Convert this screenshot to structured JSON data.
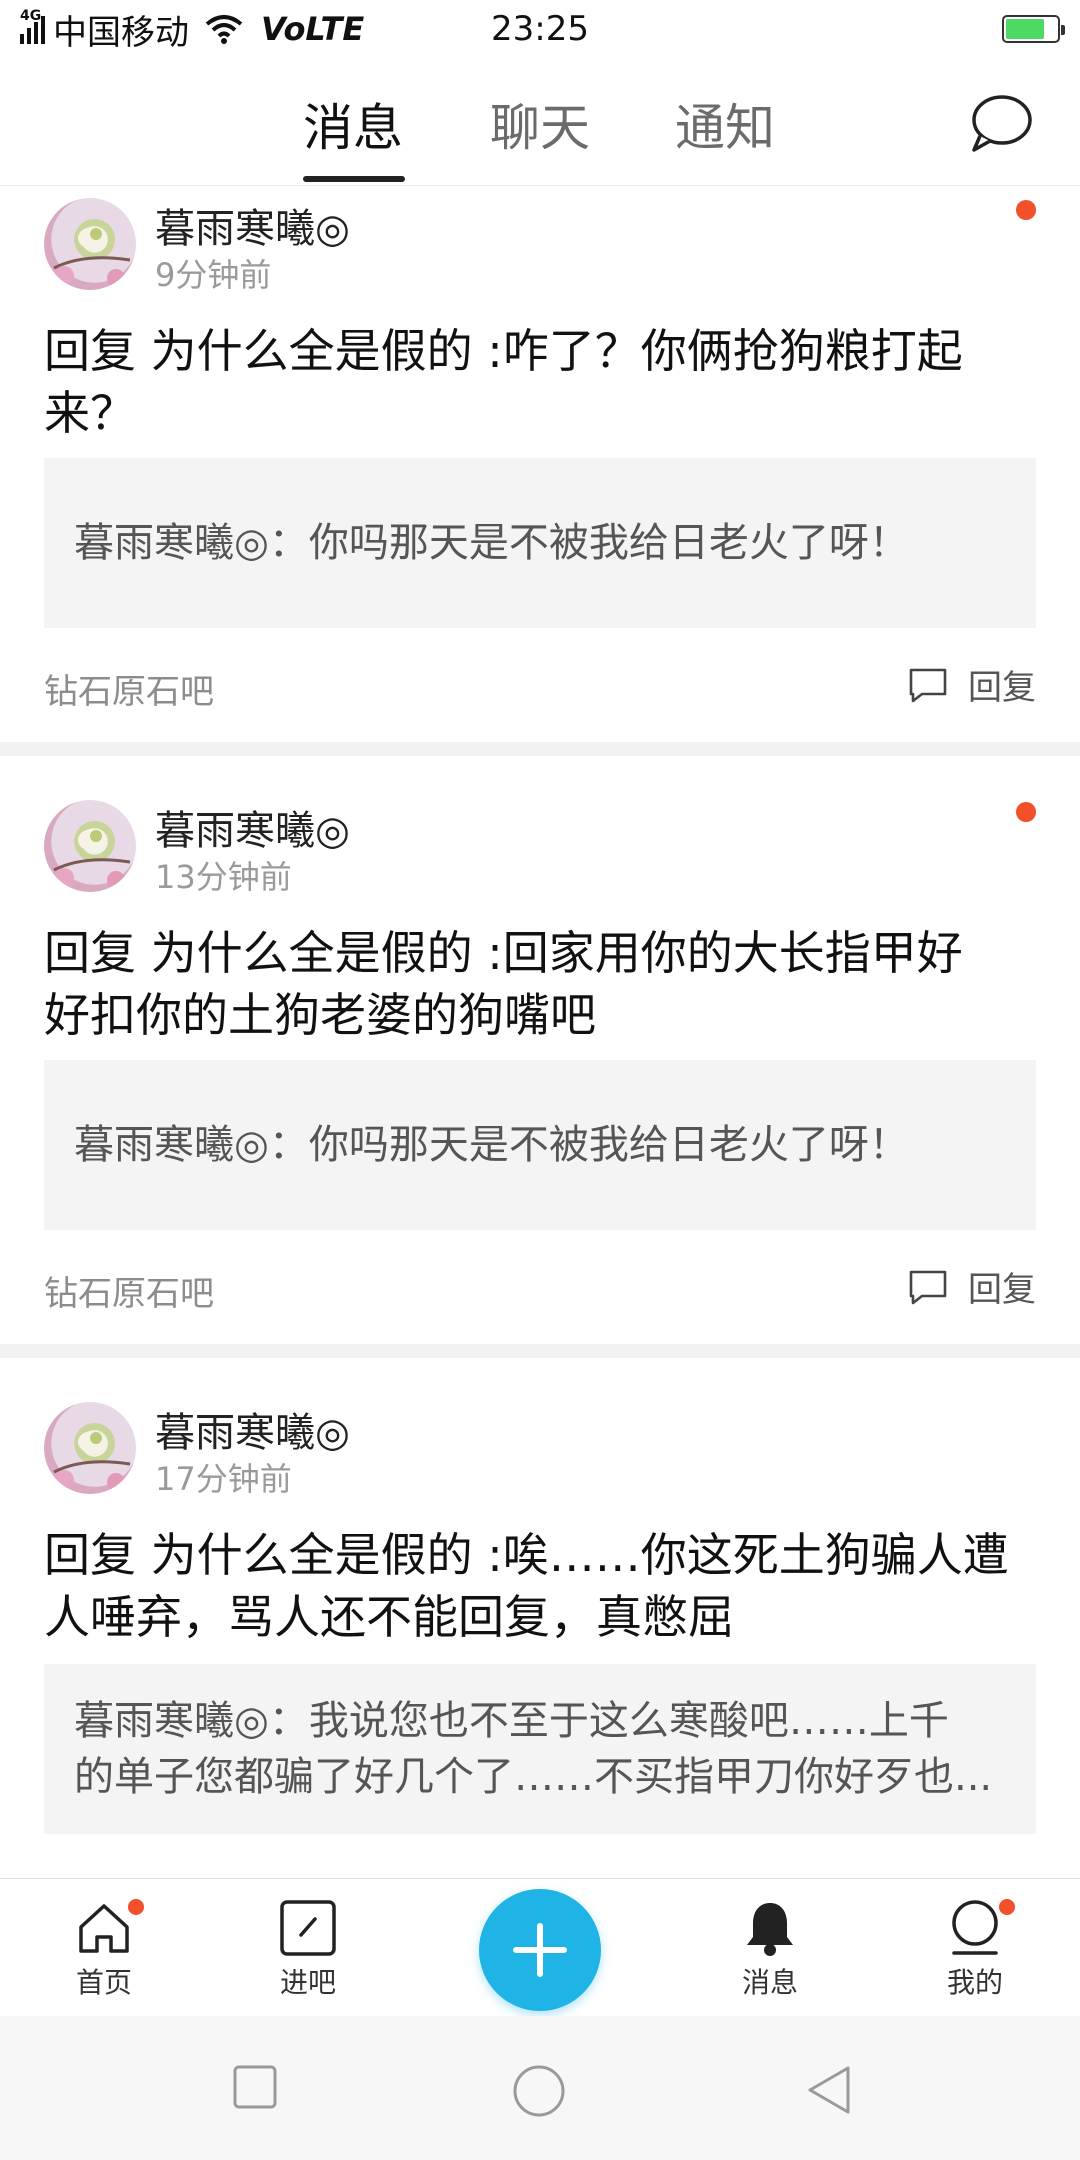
{
  "status_bar": {
    "network_type": "4G",
    "carrier": "中国移动",
    "volte": "VoLTE",
    "time": "23:25",
    "battery_level": 0.75
  },
  "tabs": [
    {
      "label": "消息",
      "active": true
    },
    {
      "label": "聊天",
      "active": false
    },
    {
      "label": "通知",
      "active": false
    }
  ],
  "messages": [
    {
      "username": "暮雨寒曦◎",
      "time": "9分钟前",
      "reply_line1": "回复 为什么全是假的 :咋了？你俩抢狗粮打起",
      "reply_line2": "来？",
      "quote_line1": "暮雨寒曦◎：你吗那天是不被我给日老火了呀！",
      "quote_line2": "",
      "forum": "钻石原石吧",
      "reply_label": "回复",
      "unread": true
    },
    {
      "username": "暮雨寒曦◎",
      "time": "13分钟前",
      "reply_line1": "回复 为什么全是假的 :回家用你的大长指甲好",
      "reply_line2": "好扣你的土狗老婆的狗嘴吧",
      "quote_line1": "暮雨寒曦◎：你吗那天是不被我给日老火了呀！",
      "quote_line2": "",
      "forum": "钻石原石吧",
      "reply_label": "回复",
      "unread": true
    },
    {
      "username": "暮雨寒曦◎",
      "time": "17分钟前",
      "reply_line1": "回复 为什么全是假的 :唉……你这死土狗骗人遭",
      "reply_line2": "人唾弃，骂人还不能回复，真憋屈",
      "quote_line1": "暮雨寒曦◎：我说您也不至于这么寒酸吧……上千",
      "quote_line2": "的单子您都骗了好几个了……不买指甲刀你好歹也...",
      "forum": "",
      "reply_label": "",
      "unread": false
    }
  ],
  "bottom_nav": [
    {
      "label": "首页",
      "icon": "home-icon",
      "badge": true
    },
    {
      "label": "进吧",
      "icon": "enter-forum-icon",
      "badge": false
    },
    {
      "label": "",
      "icon": "plus-icon",
      "badge": false
    },
    {
      "label": "消息",
      "icon": "bell-icon",
      "badge": false
    },
    {
      "label": "我的",
      "icon": "profile-icon",
      "badge": true
    }
  ],
  "colors": {
    "accent_blue": "#1fb3e6",
    "badge_red": "#f1502b",
    "quote_bg": "#f4f4f4"
  }
}
